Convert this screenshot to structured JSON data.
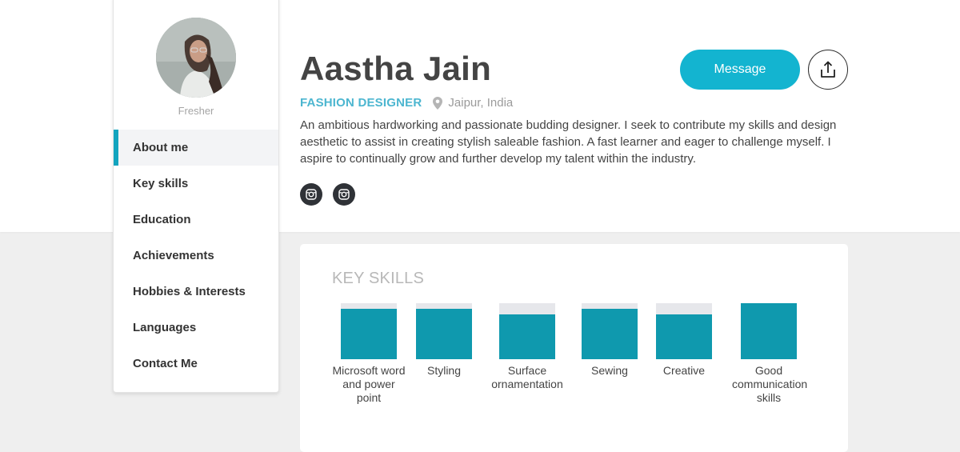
{
  "profile": {
    "name": "Aastha Jain",
    "role": "FASHION DESIGNER",
    "location": "Jaipur, India",
    "experience": "Fresher",
    "bio": "An ambitious hardworking and passionate budding designer. I seek to contribute my skills and design aesthetic to assist in creating stylish saleable fashion. A fast learner and eager to challenge myself. I aspire to continually grow and further develop my talent within the industry."
  },
  "actions": {
    "message_label": "Message",
    "share_icon": "share-upload-icon"
  },
  "social": [
    {
      "icon": "instagram-icon"
    },
    {
      "icon": "instagram-icon"
    }
  ],
  "sidebar": {
    "items": [
      {
        "label": "About me",
        "active": true
      },
      {
        "label": "Key skills",
        "active": false
      },
      {
        "label": "Education",
        "active": false
      },
      {
        "label": "Achievements",
        "active": false
      },
      {
        "label": "Hobbies & Interests",
        "active": false
      },
      {
        "label": "Languages",
        "active": false
      },
      {
        "label": "Contact Me",
        "active": false
      }
    ]
  },
  "skills": {
    "title": "KEY SKILLS",
    "items": [
      {
        "label": "Microsoft word and power point",
        "level": 0.9
      },
      {
        "label": "Styling",
        "level": 0.9
      },
      {
        "label": "Surface ornamentation",
        "level": 0.8
      },
      {
        "label": "Sewing",
        "level": 0.9
      },
      {
        "label": "Creative",
        "level": 0.8
      },
      {
        "label": "Good communication skills",
        "level": 1.0
      }
    ]
  },
  "colors": {
    "accent": "#13b4d0",
    "skill_fill": "#0f99ae",
    "role_text": "#4cb6d0"
  }
}
